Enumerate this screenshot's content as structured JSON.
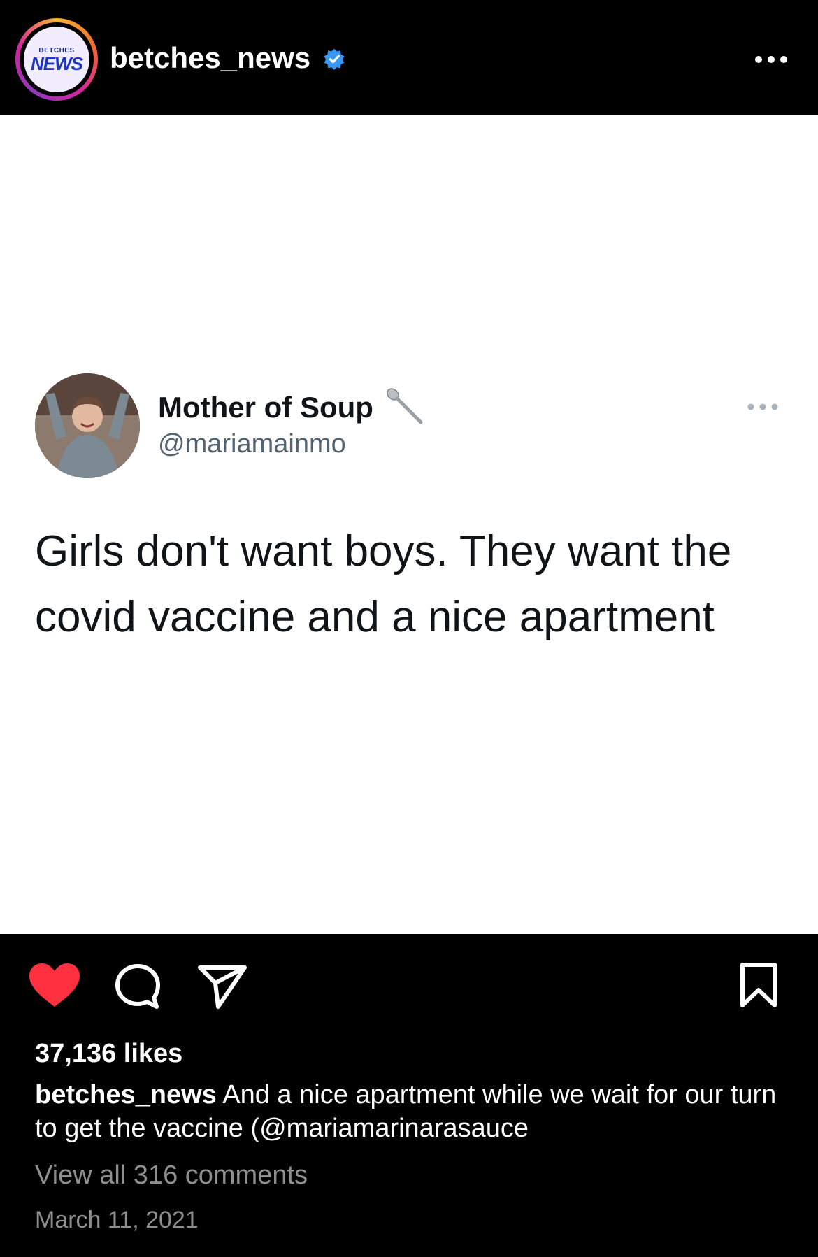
{
  "header": {
    "avatar_logo_small": "BETCHES",
    "avatar_logo_big": "NEWS",
    "username": "betches_news"
  },
  "tweet": {
    "display_name": "Mother of Soup",
    "handle": "@mariamainmo",
    "emoji": "spoon",
    "text": "Girls don't want boys. They want the covid vaccine and a nice apartment"
  },
  "actions": {
    "liked": true,
    "like_color": "#ff3040"
  },
  "post": {
    "likes": "37,136 likes",
    "caption_user": "betches_news",
    "caption_text": " And a nice apartment while we wait for our turn to get the vaccine (@mariamarinarasauce",
    "view_comments": "View all 316 comments",
    "date": "March 11, 2021"
  },
  "colors": {
    "verified": "#3897f0",
    "background": "#000000",
    "post_background": "#ffffff",
    "muted": "#8e8e8e"
  }
}
